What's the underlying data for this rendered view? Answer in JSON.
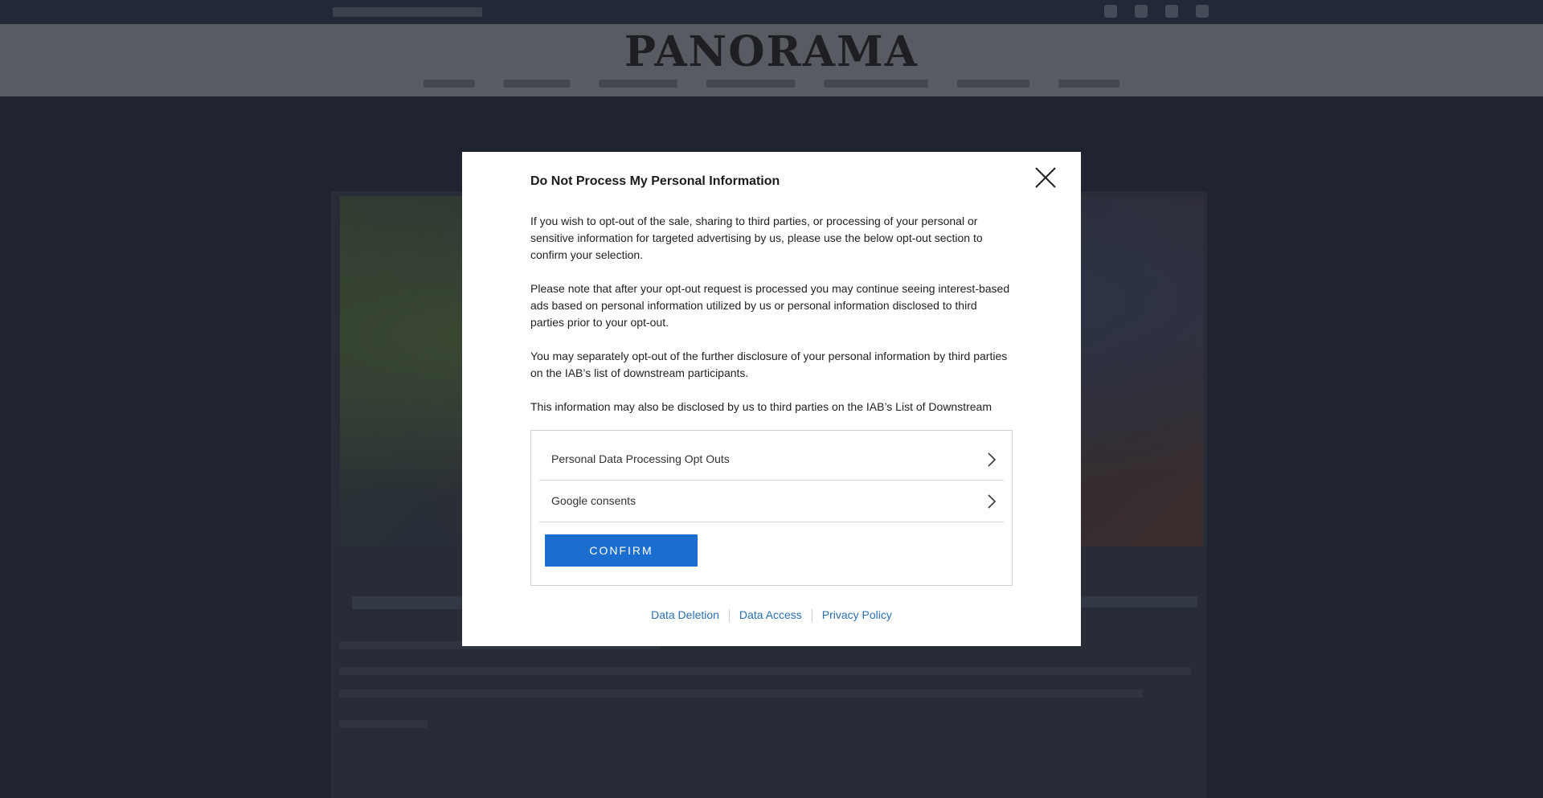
{
  "site": {
    "logo_text": "PANORAMA"
  },
  "modal": {
    "title": "Do Not Process My Personal Information",
    "close_icon": "close-icon",
    "paragraphs": [
      "If you wish to opt-out of the sale, sharing to third parties, or processing of your personal or sensitive information for targeted advertising by us, please use the below opt-out section to confirm your selection.",
      "Please note that after your opt-out request is processed you may continue seeing interest-based ads based on personal information utilized by us or personal information disclosed to third parties prior to your opt-out.",
      "You may separately opt-out of the further disclosure of your personal information by third parties on the IAB’s list of downstream participants.",
      "This information may also be disclosed by us to third parties on the IAB’s List of Downstream"
    ],
    "options": [
      {
        "label": "Personal Data Processing Opt Outs",
        "icon": "chevron-right-icon"
      },
      {
        "label": "Google consents",
        "icon": "chevron-right-icon"
      }
    ],
    "confirm_label": "CONFIRM",
    "footer_links": [
      "Data Deletion",
      "Data Access",
      "Privacy Policy"
    ]
  },
  "colors": {
    "confirm_bg": "#1b6ed0",
    "link": "#2a6fb5",
    "page_dim_bg": "#1f2430"
  }
}
